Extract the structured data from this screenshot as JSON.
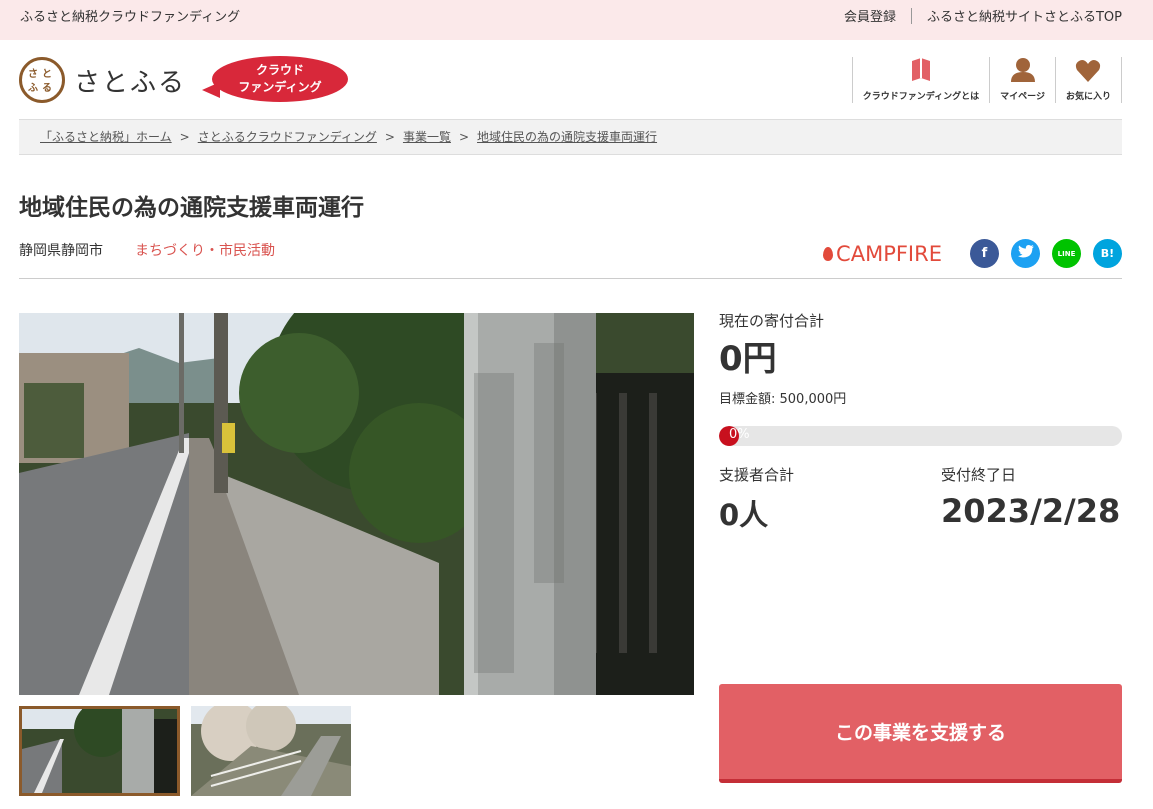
{
  "topbar": {
    "site_label": "ふるさと納税クラウドファンディング",
    "member_register": "会員登録",
    "satofull_top": "ふるさと納税サイトさとふるTOP"
  },
  "header": {
    "logo_text": "さとふる",
    "logo_mark": "さとふる",
    "badge_line1": "クラウド",
    "badge_line2": "ファンディング",
    "nav": [
      {
        "label": "クラウドファンディングとは",
        "icon": "book-icon"
      },
      {
        "label": "マイページ",
        "icon": "user-icon"
      },
      {
        "label": "お気に入り",
        "icon": "heart-icon"
      }
    ]
  },
  "breadcrumb": [
    "「ふるさと納税」ホーム",
    "さとふるクラウドファンディング",
    "事業一覧",
    "地域住民の為の通院支援車両運行"
  ],
  "breadcrumb_sep": ">",
  "project": {
    "title": "地域住民の為の通院支援車両運行",
    "location": "静岡県静岡市",
    "category": "まちづくり・市民活動",
    "campfire_label": "CAMPFIRE"
  },
  "social": {
    "facebook": "f",
    "twitter": "t",
    "line": "LINE",
    "hatena": "B!"
  },
  "stats": {
    "total_label": "現在の寄付合計",
    "total_value": "0円",
    "goal_text": "目標金額: 500,000円",
    "progress_percent": 0,
    "progress_label": "0%",
    "supporters_label": "支援者合計",
    "supporters_value": "0人",
    "deadline_label": "受付終了日",
    "deadline_value": "2023/2/28"
  },
  "support_button": "この事業を支援する",
  "colors": {
    "accent": "#e26065",
    "brand_brown": "#8b5a2b",
    "category": "#d9534f",
    "facebook": "#3b5998",
    "twitter": "#1da1f2",
    "line": "#00c300",
    "hatena": "#00a4de"
  }
}
